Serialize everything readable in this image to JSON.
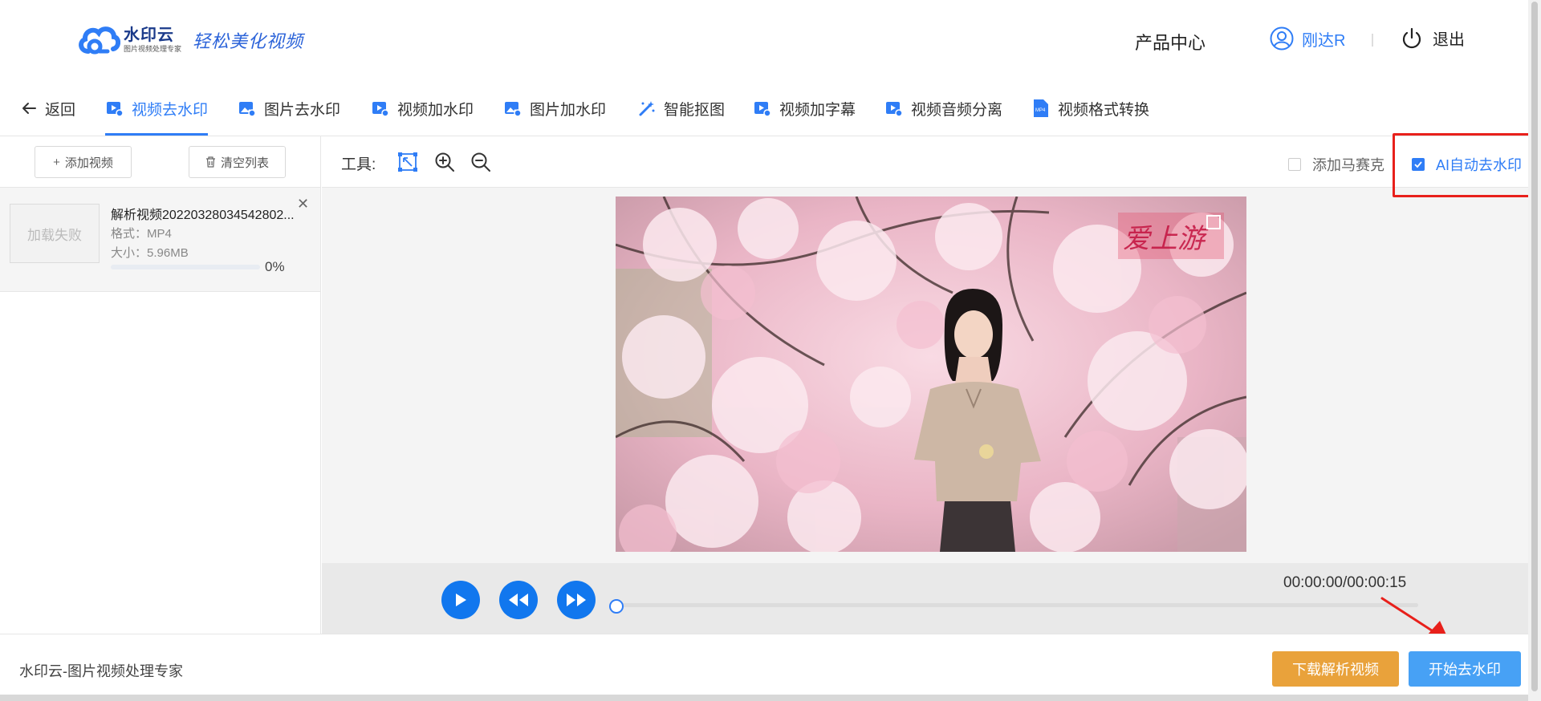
{
  "header": {
    "logo_name": "水印云",
    "logo_sub": "图片视频处理专家",
    "logo_slogan": "轻松美化视频",
    "product_center": "产品中心",
    "username": "刚达R",
    "logout": "退出"
  },
  "tabs": {
    "back": "返回",
    "items": [
      {
        "label": "视频去水印",
        "icon": "video-icon",
        "active": true
      },
      {
        "label": "图片去水印",
        "icon": "image-icon",
        "active": false
      },
      {
        "label": "视频加水印",
        "icon": "video-icon",
        "active": false
      },
      {
        "label": "图片加水印",
        "icon": "image-icon",
        "active": false
      },
      {
        "label": "智能抠图",
        "icon": "magic-wand-icon",
        "active": false
      },
      {
        "label": "视频加字幕",
        "icon": "video-icon",
        "active": false
      },
      {
        "label": "视频音频分离",
        "icon": "video-icon",
        "active": false
      },
      {
        "label": "视频格式转换",
        "icon": "mp4-file-icon",
        "active": false
      }
    ]
  },
  "left_panel": {
    "add_video": "添加视频",
    "clear_list": "清空列表",
    "file": {
      "thumb_status": "加载失败",
      "name": "解析视频20220328034542802...",
      "format": "格式：MP4",
      "size": "大小：5.96MB",
      "progress_percent": 0,
      "progress_label": "0%"
    }
  },
  "editor": {
    "tools_label": "工具:",
    "mosaic_label": "添加马赛克",
    "mosaic_checked": false,
    "ai_remove_label": "AI自动去水印",
    "ai_remove_checked": true,
    "time": "00:00:00/00:00:15",
    "playback_progress": 0
  },
  "footer": {
    "brand": "水印云-图片视频处理专家",
    "download_parsed": "下载解析视频",
    "start_remove": "开始去水印"
  },
  "colors": {
    "accent": "#2f7df6",
    "play_button": "#1177ee",
    "orange": "#e9a23b",
    "blue_button": "#47a1f5",
    "highlight": "#e8201b"
  }
}
